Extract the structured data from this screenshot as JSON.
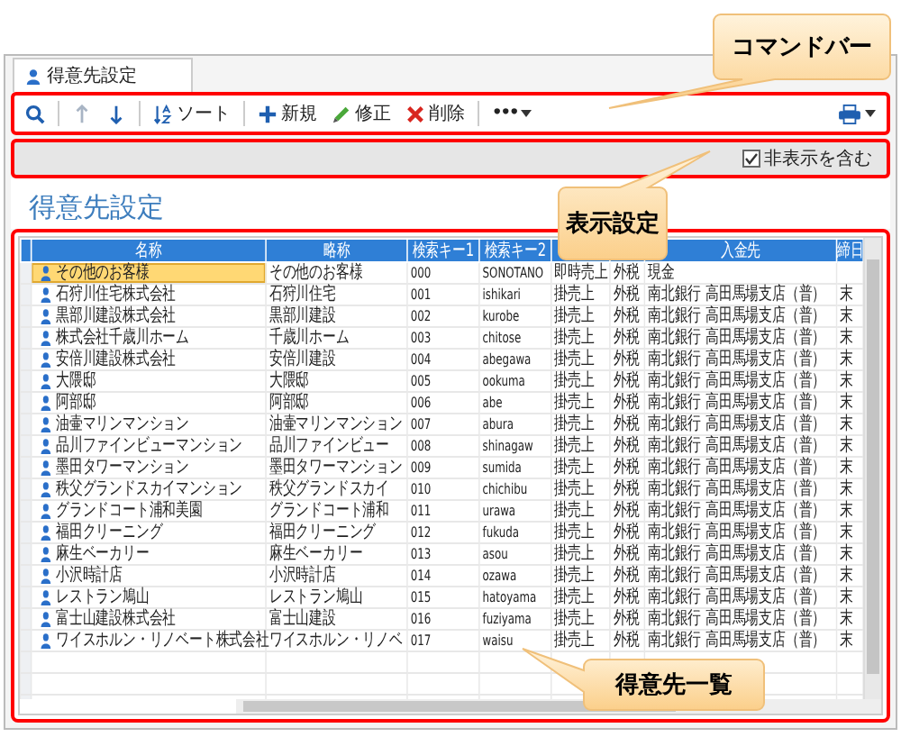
{
  "tab": {
    "label": "得意先設定",
    "selected": true
  },
  "toolbar": {
    "items": [
      {
        "kind": "search"
      },
      {
        "kind": "up",
        "disabled": true
      },
      {
        "kind": "down",
        "disabled": false
      },
      {
        "kind": "sort",
        "label": "ソート"
      },
      {
        "kind": "new",
        "label": "新規"
      },
      {
        "kind": "edit",
        "label": "修正"
      },
      {
        "kind": "delete",
        "label": "削除"
      },
      {
        "kind": "more",
        "label": "•••"
      },
      {
        "kind": "print"
      }
    ]
  },
  "options_bar": {
    "checkbox": {
      "label": "非表示を含む",
      "checked": true
    }
  },
  "page_title": "得意先設定",
  "table": {
    "columns": [
      "名称",
      "略称",
      "検索キー1",
      "検索キー2",
      "入金先",
      "締日"
    ],
    "rows": [
      {
        "name": "その他のお客様",
        "short": "その他のお客様",
        "key1": "000",
        "key2": "SONOTANO",
        "column_5": "即時売上",
        "column_6": "外税",
        "payee": "現金",
        "selected": true
      },
      {
        "name": "石狩川住宅株式会社",
        "short": "石狩川住宅",
        "key1": "001",
        "key2": "ishikari",
        "column_5": "掛売上",
        "column_6": "外税",
        "payee": "南北銀行 高田馬場支店（普）",
        "closing": "末",
        "selected": false
      },
      {
        "name": "黒部川建設株式会社",
        "short": "黒部川建設",
        "key1": "002",
        "key2": "kurobe",
        "column_5": "掛売上",
        "column_6": "外税",
        "payee": "南北銀行 高田馬場支店（普）",
        "closing": "末",
        "selected": false
      },
      {
        "name": "株式会社千歳川ホーム",
        "short": "千歳川ホーム",
        "key1": "003",
        "key2": "chitose",
        "column_5": "掛売上",
        "column_6": "外税",
        "payee": "南北銀行 高田馬場支店（普）",
        "closing": "末",
        "selected": false
      },
      {
        "name": "安倍川建設株式会社",
        "short": "安倍川建設",
        "key1": "004",
        "key2": "abegawa",
        "column_5": "掛売上",
        "column_6": "外税",
        "payee": "南北銀行 高田馬場支店（普）",
        "closing": "末",
        "selected": false
      },
      {
        "name": "大隈邸",
        "short": "大隈邸",
        "key1": "005",
        "key2": "ookuma",
        "column_5": "掛売上",
        "column_6": "外税",
        "payee": "南北銀行 高田馬場支店（普）",
        "closing": "末",
        "selected": false
      },
      {
        "name": "阿部邸",
        "short": "阿部邸",
        "key1": "006",
        "key2": "abe",
        "column_5": "掛売上",
        "column_6": "外税",
        "payee": "南北銀行 高田馬場支店（普）",
        "closing": "末",
        "selected": false
      },
      {
        "name": "油壷マリンマンション",
        "short": "油壷マリンマンション",
        "key1": "007",
        "key2": "abura",
        "column_5": "掛売上",
        "column_6": "外税",
        "payee": "南北銀行 高田馬場支店（普）",
        "closing": "末",
        "selected": false
      },
      {
        "name": "品川ファインビューマンション",
        "short": "品川ファインビュー",
        "key1": "008",
        "key2": "shinagaw",
        "column_5": "掛売上",
        "column_6": "外税",
        "payee": "南北銀行 高田馬場支店（普）",
        "closing": "末",
        "selected": false
      },
      {
        "name": "墨田タワーマンション",
        "short": "墨田タワーマンション",
        "key1": "009",
        "key2": "sumida",
        "column_5": "掛売上",
        "column_6": "外税",
        "payee": "南北銀行 高田馬場支店（普）",
        "closing": "末",
        "selected": false
      },
      {
        "name": "秩父グランドスカイマンション",
        "short": "秩父グランドスカイ",
        "key1": "010",
        "key2": "chichibu",
        "column_5": "掛売上",
        "column_6": "外税",
        "payee": "南北銀行 高田馬場支店（普）",
        "closing": "末",
        "selected": false
      },
      {
        "name": "グランドコート浦和美園",
        "short": "グランドコート浦和",
        "key1": "011",
        "key2": "urawa",
        "column_5": "掛売上",
        "column_6": "外税",
        "payee": "南北銀行 高田馬場支店（普）",
        "closing": "末",
        "selected": false
      },
      {
        "name": "福田クリーニング",
        "short": "福田クリーニング",
        "key1": "012",
        "key2": "fukuda",
        "column_5": "掛売上",
        "column_6": "外税",
        "payee": "南北銀行 高田馬場支店（普）",
        "closing": "末",
        "selected": false
      },
      {
        "name": "麻生ベーカリー",
        "short": "麻生ベーカリー",
        "key1": "013",
        "key2": "asou",
        "column_5": "掛売上",
        "column_6": "外税",
        "payee": "南北銀行 高田馬場支店（普）",
        "closing": "末",
        "selected": false
      },
      {
        "name": "小沢時計店",
        "short": "小沢時計店",
        "key1": "014",
        "key2": "ozawa",
        "column_5": "掛売上",
        "column_6": "外税",
        "payee": "南北銀行 高田馬場支店（普）",
        "closing": "末",
        "selected": false
      },
      {
        "name": "レストラン鳩山",
        "short": "レストラン鳩山",
        "key1": "015",
        "key2": "hatoyama",
        "column_5": "掛売上",
        "column_6": "外税",
        "payee": "南北銀行 高田馬場支店（普）",
        "closing": "末",
        "selected": false
      },
      {
        "name": "富士山建設株式会社",
        "short": "富士山建設",
        "key1": "016",
        "key2": "fuziyama",
        "column_5": "掛売上",
        "column_6": "外税",
        "payee": "南北銀行 高田馬場支店（普）",
        "closing": "末",
        "selected": false
      },
      {
        "name": "ワイスホルン・リノベート株式会社",
        "short": "ワイスホルン・リノベ",
        "key1": "017",
        "key2": "waisu",
        "column_5": "掛売上",
        "column_6": "外税",
        "payee": "南北銀行 高田馬場支店（普）",
        "closing": "末",
        "selected": false
      }
    ]
  },
  "callouts": [
    {
      "label": "コマンドバー"
    },
    {
      "label": "表示設定"
    },
    {
      "label": "得意先一覧"
    }
  ]
}
